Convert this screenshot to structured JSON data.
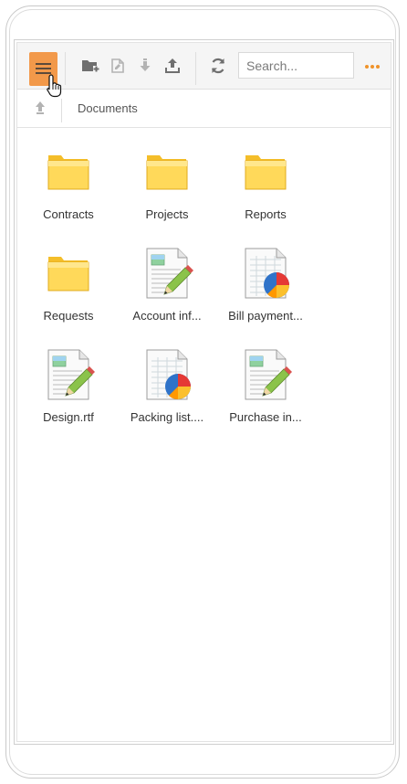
{
  "toolbar": {
    "menu_icon": "hamburger-menu-icon",
    "search_placeholder": "Search...",
    "buttons": [
      "new-folder-icon",
      "rename-icon",
      "download-icon",
      "upload-icon",
      "refresh-icon",
      "more-options-icon"
    ]
  },
  "breadcrumb": {
    "up_icon": "arrow-up-icon",
    "current": "Documents"
  },
  "items": [
    {
      "label": "Contracts",
      "type": "folder"
    },
    {
      "label": "Projects",
      "type": "folder"
    },
    {
      "label": "Reports",
      "type": "folder"
    },
    {
      "label": "Requests",
      "type": "folder"
    },
    {
      "label": "Account inf...",
      "type": "doc"
    },
    {
      "label": "Bill payment...",
      "type": "sheet"
    },
    {
      "label": "Design.rtf",
      "type": "doc"
    },
    {
      "label": "Packing list....",
      "type": "sheet"
    },
    {
      "label": "Purchase in...",
      "type": "doc"
    }
  ],
  "colors": {
    "accent": "#f2994a",
    "folder": "#ffd54f",
    "more_dots": "#f0932b"
  }
}
